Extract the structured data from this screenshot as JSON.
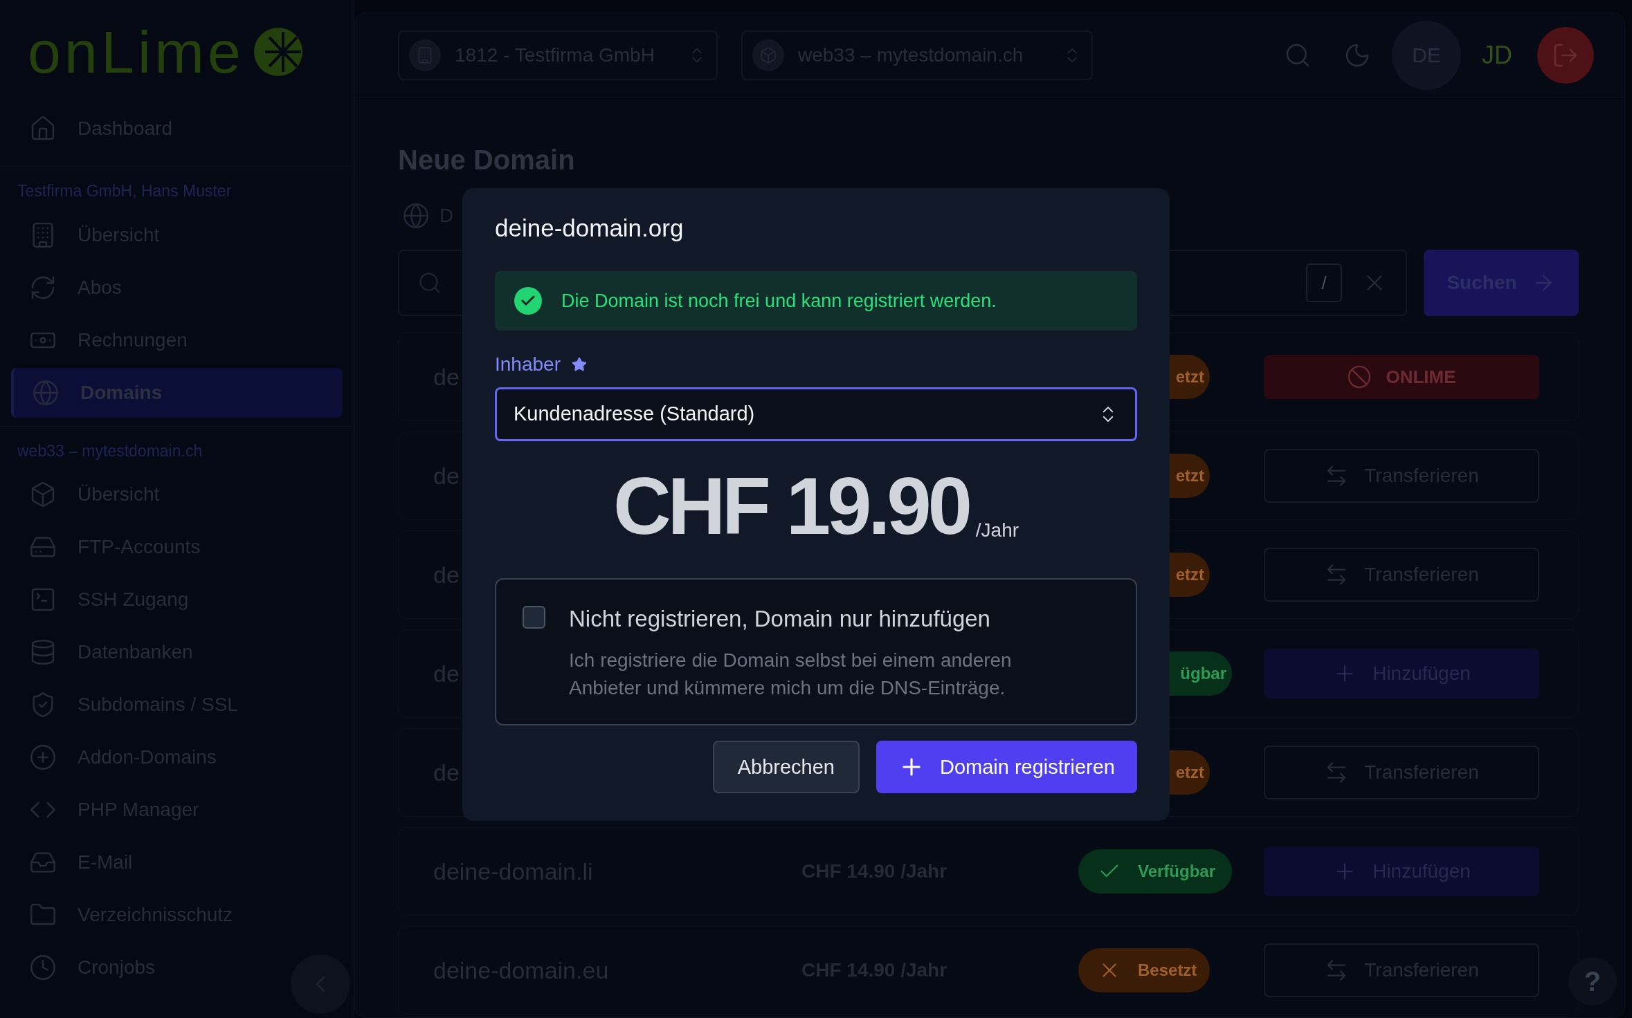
{
  "sidebar": {
    "logo": "onLime",
    "groups": [
      {
        "items": [
          {
            "label": "Dashboard",
            "selected": false
          }
        ]
      },
      {
        "title": "Testfirma GmbH, Hans Muster",
        "items": [
          {
            "label": "Übersicht",
            "selected": false
          },
          {
            "label": "Abos",
            "selected": false
          },
          {
            "label": "Rechnungen",
            "selected": false
          },
          {
            "label": "Domains",
            "selected": true
          }
        ]
      },
      {
        "title": "web33 – mytestdomain.ch",
        "items": [
          {
            "label": "Übersicht",
            "selected": false
          },
          {
            "label": "FTP-Accounts",
            "selected": false
          },
          {
            "label": "SSH Zugang",
            "selected": false
          },
          {
            "label": "Datenbanken",
            "selected": false
          },
          {
            "label": "Subdomains / SSL",
            "selected": false
          },
          {
            "label": "Addon-Domains",
            "selected": false
          },
          {
            "label": "PHP Manager",
            "selected": false
          },
          {
            "label": "E-Mail",
            "selected": false
          },
          {
            "label": "Verzeichnisschutz",
            "selected": false
          },
          {
            "label": "Cronjobs",
            "selected": false
          }
        ]
      }
    ]
  },
  "header": {
    "selectors": [
      "1812 - Testfirma GmbH",
      "web33 – mytestdomain.ch"
    ],
    "language": "DE",
    "user_initials": "JD"
  },
  "page": {
    "title": "Neue Domain",
    "tab_fragment": "D",
    "search": {
      "shortcut": "/",
      "button": "Suchen"
    },
    "rows": [
      {
        "name": "de",
        "badge": {
          "kind": "taken",
          "label": "etzt"
        },
        "action": {
          "kind": "blocked",
          "label": "ONLIME"
        }
      },
      {
        "name": "de",
        "badge": {
          "kind": "taken",
          "label": "etzt"
        },
        "action": {
          "kind": "transfer",
          "label": "Transferieren"
        }
      },
      {
        "name": "de",
        "badge": {
          "kind": "taken",
          "label": "etzt"
        },
        "action": {
          "kind": "transfer",
          "label": "Transferieren"
        }
      },
      {
        "name": "de",
        "badge": {
          "kind": "available",
          "label": "ügbar"
        },
        "action": {
          "kind": "add",
          "label": "Hinzufügen"
        }
      },
      {
        "name": "de",
        "badge": {
          "kind": "taken",
          "label": "etzt"
        },
        "action": {
          "kind": "transfer",
          "label": "Transferieren"
        }
      },
      {
        "name": "deine-domain.li",
        "price": "CHF 14.90 /Jahr",
        "badge": {
          "kind": "available",
          "label": "Verfügbar"
        },
        "action": {
          "kind": "add",
          "label": "Hinzufügen"
        }
      },
      {
        "name": "deine-domain.eu",
        "price": "CHF 14.90 /Jahr",
        "badge": {
          "kind": "taken",
          "label": "Besetzt"
        },
        "action": {
          "kind": "transfer",
          "label": "Transferieren"
        }
      }
    ],
    "help": "?"
  },
  "modal": {
    "title": "deine-domain.org",
    "notice": "Die Domain ist noch frei und kann registriert werden.",
    "owner": {
      "label": "Inhaber",
      "required": true,
      "value": "Kundenadresse (Standard)"
    },
    "price": "CHF 19.90",
    "price_unit": "/Jahr",
    "option": {
      "checked": false,
      "title": "Nicht registrieren, Domain nur hinzufügen",
      "description": "Ich registriere die Domain selbst bei einem anderen Anbieter und kümmere mich um die DNS-Einträge."
    },
    "buttons": [
      {
        "label": "Abbrechen",
        "kind": "secondary"
      },
      {
        "label": "Domain registrieren",
        "kind": "primary"
      }
    ]
  }
}
